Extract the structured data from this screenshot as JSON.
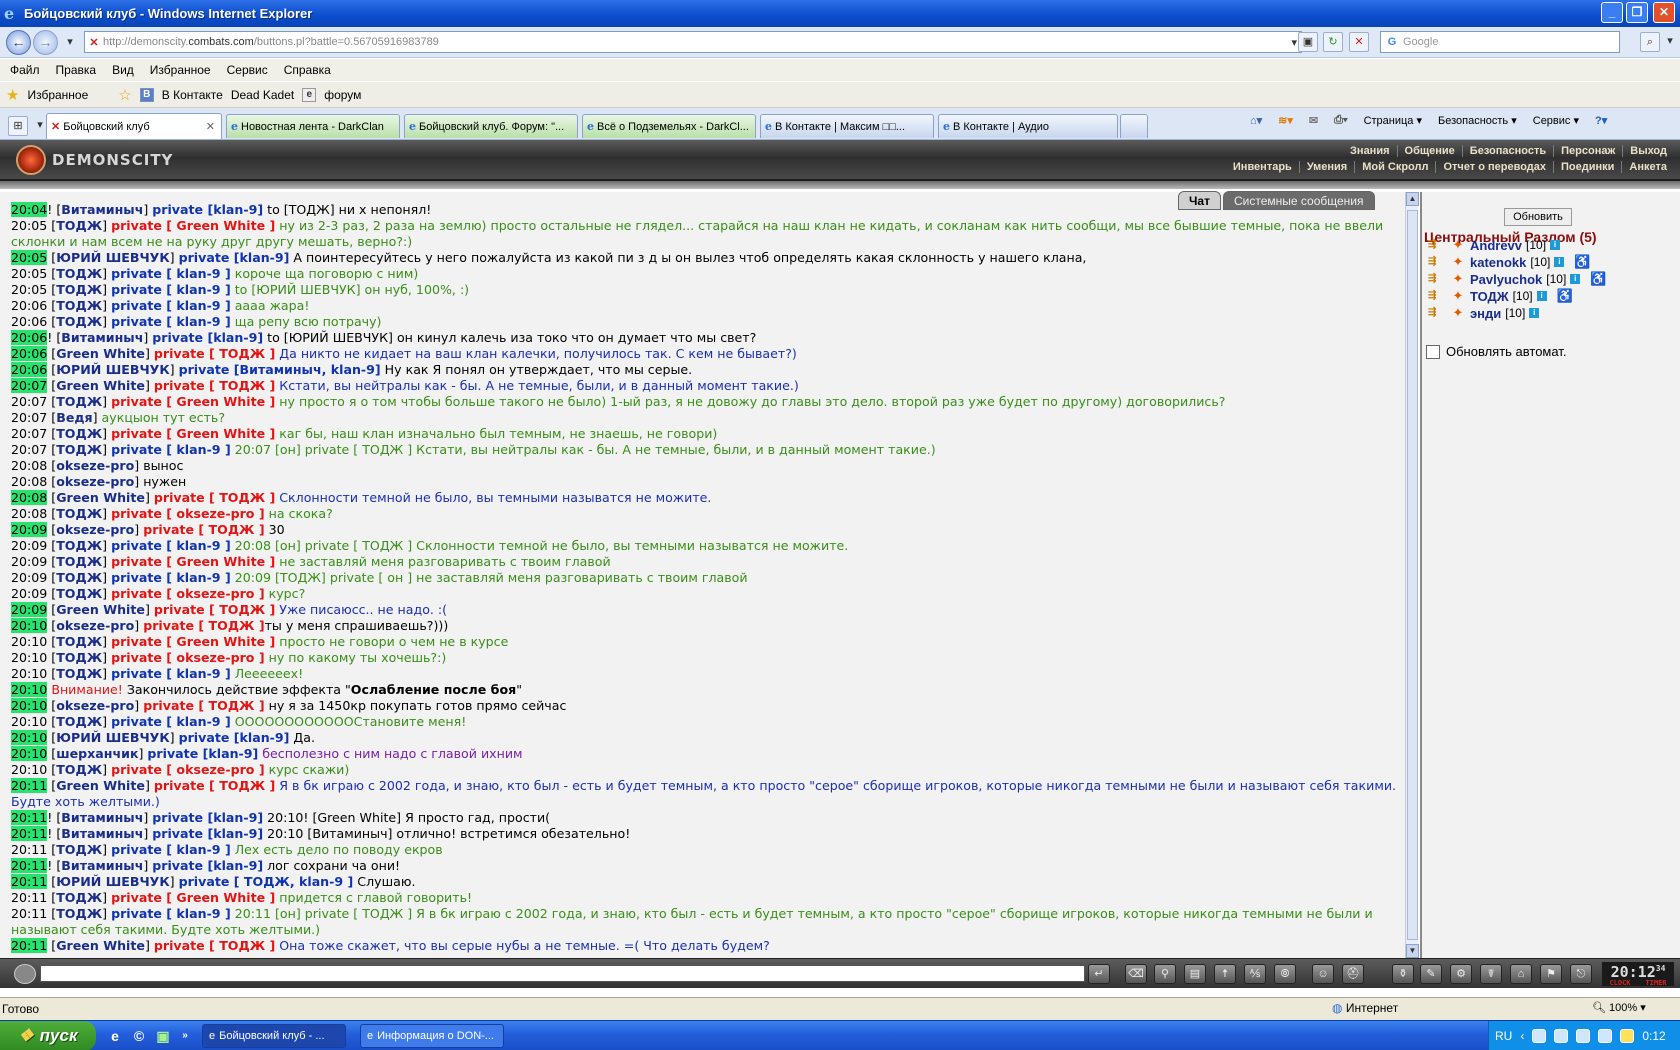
{
  "window": {
    "title": "Бойцовский клуб - Windows Internet Explorer"
  },
  "address": {
    "prefix": "http://demonscity.",
    "domain": "combats.com",
    "path": "/buttons.pl?battle=0.56705916983789"
  },
  "search": {
    "placeholder": "Google"
  },
  "menu": [
    "Файл",
    "Правка",
    "Вид",
    "Избранное",
    "Сервис",
    "Справка"
  ],
  "favorites": {
    "label": "Избранное",
    "items": [
      "В Контакте",
      "Dead Kadet",
      "форум"
    ]
  },
  "tabs": [
    {
      "label": "Бойцовский клуб",
      "active": true
    },
    {
      "label": "Новостная лента - DarkClan",
      "active": false
    },
    {
      "label": "Бойцовский клуб. Форум: \"...",
      "active": false
    },
    {
      "label": "Всё о Подземельях - DarkCl...",
      "active": false
    },
    {
      "label": "В Контакте | Максим □□...",
      "active": false
    },
    {
      "label": "В Контакте | Аудио",
      "active": false
    }
  ],
  "command_bar": [
    "Страница",
    "Безопасность",
    "Сервис"
  ],
  "game": {
    "logo": "DEMONSCITY",
    "nav_top": [
      "Знания",
      "Общение",
      "Безопасность",
      "Персонаж",
      "Выход"
    ],
    "nav_bottom": [
      "Инвентарь",
      "Умения",
      "Мой Скролл",
      "Отчет о переводах",
      "Поединки",
      "Анкета"
    ],
    "chat_tabs": [
      "Чат",
      "Системные сообщения"
    ]
  },
  "chat": [
    {
      "time": "20:04",
      "hl": true,
      "excl": true,
      "nick": "Витаминыч",
      "priv": "private [klan-9]",
      "pc": "p1",
      "text": " to [ТОДЖ] ни х непонял!",
      "tc": "c-dark"
    },
    {
      "time": "20:05",
      "hl": false,
      "excl": false,
      "nick": "ТОДЖ",
      "priv": "private [ Green White ]",
      "pc": "p2",
      "text": " ну из 2-3 раз, 2 раза на землю) просто остальные не глядел... старайся на наш клан не кидать, и сокланам как нить сообщи, мы все бывшие темные, пока не ввели склонки и нам всем не на руку друг другу мешать, верно?:)",
      "tc": "c-green"
    },
    {
      "time": "20:05",
      "hl": true,
      "excl": false,
      "nick": "ЮРИЙ ШЕВЧУК",
      "priv": "private [klan-9]",
      "pc": "p1",
      "text": " А поинтересуйтесь у него пожалуйста из какой пи з д ы он вылез чтоб определять какая склонность у нашего клана,",
      "tc": "c-dark"
    },
    {
      "time": "20:05",
      "hl": false,
      "excl": false,
      "nick": "ТОДЖ",
      "priv": "private [ klan-9 ]",
      "pc": "p1",
      "text": " короче ща поговорю с ним)",
      "tc": "c-green"
    },
    {
      "time": "20:05",
      "hl": false,
      "excl": false,
      "nick": "ТОДЖ",
      "priv": "private [ klan-9 ]",
      "pc": "p1",
      "text": " to [ЮРИЙ ШЕВЧУК] он нуб, 100%, :)",
      "tc": "c-green"
    },
    {
      "time": "20:06",
      "hl": false,
      "excl": false,
      "nick": "ТОДЖ",
      "priv": "private [ klan-9 ]",
      "pc": "p1",
      "text": " аааа жара!",
      "tc": "c-green"
    },
    {
      "time": "20:06",
      "hl": false,
      "excl": false,
      "nick": "ТОДЖ",
      "priv": "private [ klan-9 ]",
      "pc": "p1",
      "text": " ща репу всю потрачу)",
      "tc": "c-green"
    },
    {
      "time": "20:06",
      "hl": true,
      "excl": true,
      "nick": "Витаминыч",
      "priv": "private [klan-9]",
      "pc": "p1",
      "text": " to [ЮРИЙ ШЕВЧУК] он кинул калечь иза токо что он думает что мы свет?",
      "tc": "c-dark"
    },
    {
      "time": "20:06",
      "hl": true,
      "excl": false,
      "nick": "Green White",
      "priv": "private [ ТОДЖ ]",
      "pc": "p2",
      "text": " Да никто не кидает на ваш клан калечки, получилось так. С кем не бывает?)",
      "tc": "c-blue"
    },
    {
      "time": "20:06",
      "hl": true,
      "excl": false,
      "nick": "ЮРИЙ ШЕВЧУК",
      "priv": "private [Витаминыч, klan-9]",
      "pc": "p1",
      "text": " Ну как Я понял он утверждает, что мы серые.",
      "tc": "c-dark"
    },
    {
      "time": "20:07",
      "hl": true,
      "excl": false,
      "nick": "Green White",
      "priv": "private [ ТОДЖ ]",
      "pc": "p2",
      "text": " Кстати, вы нейтралы как - бы. А не темные, были, и в данный момент такие.)",
      "tc": "c-blue"
    },
    {
      "time": "20:07",
      "hl": false,
      "excl": false,
      "nick": "ТОДЖ",
      "priv": "private [ Green White ]",
      "pc": "p2",
      "text": " ну просто я о том чтобы больше такого не было) 1-ый раз, я не довожу до главы это дело. второй раз уже будет по другому) договорились?",
      "tc": "c-green"
    },
    {
      "time": "20:07",
      "hl": false,
      "excl": false,
      "nick": "Ведя",
      "priv": "",
      "pc": "p1",
      "text": " аукцыон тут есть?",
      "tc": "c-green"
    },
    {
      "time": "20:07",
      "hl": false,
      "excl": false,
      "nick": "ТОДЖ",
      "priv": "private [ Green White ]",
      "pc": "p2",
      "text": " каг бы, наш клан изначально был темным, не знаешь, не говори)",
      "tc": "c-green"
    },
    {
      "time": "20:07",
      "hl": false,
      "excl": false,
      "nick": "ТОДЖ",
      "priv": "private [ klan-9 ]",
      "pc": "p1",
      "text": " 20:07 [он] private [ ТОДЖ ] Кстати, вы нейтралы как - бы. А не темные, были, и в данный момент такие.)",
      "tc": "c-green"
    },
    {
      "time": "20:08",
      "hl": false,
      "excl": false,
      "nick": "okseze-pro",
      "priv": "",
      "pc": "p1",
      "text": " вынос",
      "tc": "c-dark"
    },
    {
      "time": "20:08",
      "hl": false,
      "excl": false,
      "nick": "okseze-pro",
      "priv": "",
      "pc": "p1",
      "text": " нужен",
      "tc": "c-dark"
    },
    {
      "time": "20:08",
      "hl": true,
      "excl": false,
      "nick": "Green White",
      "priv": "private [ ТОДЖ ]",
      "pc": "p2",
      "text": " Склонности темной не было, вы темными называтся не можите.",
      "tc": "c-blue"
    },
    {
      "time": "20:08",
      "hl": false,
      "excl": false,
      "nick": "ТОДЖ",
      "priv": "private [ okseze-pro ]",
      "pc": "p2",
      "text": " на скока?",
      "tc": "c-green"
    },
    {
      "time": "20:09",
      "hl": true,
      "excl": false,
      "nick": "okseze-pro",
      "priv": "private [ ТОДЖ ]",
      "pc": "p2",
      "text": " 30",
      "tc": "c-dark"
    },
    {
      "time": "20:09",
      "hl": false,
      "excl": false,
      "nick": "ТОДЖ",
      "priv": "private [ klan-9 ]",
      "pc": "p1",
      "text": " 20:08 [он] private [ ТОДЖ ] Склонности темной не было, вы темными называтся не можите.",
      "tc": "c-green"
    },
    {
      "time": "20:09",
      "hl": false,
      "excl": false,
      "nick": "ТОДЖ",
      "priv": "private [ Green White ]",
      "pc": "p2",
      "text": " не заставляй меня разговаривать с твоим главой",
      "tc": "c-green"
    },
    {
      "time": "20:09",
      "hl": false,
      "excl": false,
      "nick": "ТОДЖ",
      "priv": "private [ klan-9 ]",
      "pc": "p1",
      "text": " 20:09 [ТОДЖ] private [ он ] не заставляй меня разговаривать с твоим главой",
      "tc": "c-green"
    },
    {
      "time": "20:09",
      "hl": false,
      "excl": false,
      "nick": "ТОДЖ",
      "priv": "private [ okseze-pro ]",
      "pc": "p2",
      "text": " курс?",
      "tc": "c-green"
    },
    {
      "time": "20:09",
      "hl": true,
      "excl": false,
      "nick": "Green White",
      "priv": "private [ ТОДЖ ]",
      "pc": "p2",
      "text": " Уже писаюсс.. не надо. :(",
      "tc": "c-blue"
    },
    {
      "time": "20:10",
      "hl": true,
      "excl": false,
      "nick": "okseze-pro",
      "priv": "private [ ТОДЖ ]",
      "pc": "p2",
      "text": "ты у меня спрашиваешь?)))",
      "tc": "c-dark"
    },
    {
      "time": "20:10",
      "hl": false,
      "excl": false,
      "nick": "ТОДЖ",
      "priv": "private [ Green White ]",
      "pc": "p2",
      "text": " просто не говори о чем не в курсе",
      "tc": "c-green"
    },
    {
      "time": "20:10",
      "hl": false,
      "excl": false,
      "nick": "ТОДЖ",
      "priv": "private [ okseze-pro ]",
      "pc": "p2",
      "text": " ну по какому ты хочешь?:)",
      "tc": "c-green"
    },
    {
      "time": "20:10",
      "hl": false,
      "excl": false,
      "nick": "ТОДЖ",
      "priv": "private [ klan-9 ]",
      "pc": "p1",
      "text": " Леееееех!",
      "tc": "c-green"
    },
    {
      "time": "20:10",
      "hl": true,
      "excl": false,
      "system": true,
      "warn": "Внимание!",
      "text": " Закончилось действие эффекта \"",
      "bold": "Ослабление после боя",
      "text2": "\""
    },
    {
      "time": "20:10",
      "hl": true,
      "excl": false,
      "nick": "okseze-pro",
      "priv": "private [ ТОДЖ ]",
      "pc": "p2",
      "text": " ну я за 1450кр покупать готов прямо сейчас",
      "tc": "c-dark"
    },
    {
      "time": "20:10",
      "hl": false,
      "excl": false,
      "nick": "ТОДЖ",
      "priv": "private [ klan-9 ]",
      "pc": "p1",
      "text": " ООООООООООООСтановите меня!",
      "tc": "c-green"
    },
    {
      "time": "20:10",
      "hl": true,
      "excl": false,
      "nick": "ЮРИЙ ШЕВЧУК",
      "priv": "private [klan-9]",
      "pc": "p1",
      "text": " Да.",
      "tc": "c-dark"
    },
    {
      "time": "20:10",
      "hl": true,
      "excl": false,
      "nick": "шерханчик",
      "priv": "private [klan-9]",
      "pc": "p1",
      "text": " бесполезно с ним надо с главой ихним",
      "tc": "c-purple"
    },
    {
      "time": "20:10",
      "hl": false,
      "excl": false,
      "nick": "ТОДЖ",
      "priv": "private [ okseze-pro ]",
      "pc": "p2",
      "text": " курс скажи)",
      "tc": "c-green"
    },
    {
      "time": "20:11",
      "hl": true,
      "excl": false,
      "nick": "Green White",
      "priv": "private [ ТОДЖ ]",
      "pc": "p2",
      "text": " Я в бк играю с 2002 года, и знаю, кто был - есть и будет темным, а кто просто \"серое\" сборище игроков, которые никогда темными не были и называют себя такими. Будте хоть желтыми.)",
      "tc": "c-blue"
    },
    {
      "time": "20:11",
      "hl": true,
      "excl": true,
      "nick": "Витаминыч",
      "priv": "private [klan-9]",
      "pc": "p1",
      "text": " 20:10! [Green White] Я просто гад, прости(",
      "tc": "c-dark"
    },
    {
      "time": "20:11",
      "hl": true,
      "excl": true,
      "nick": "Витаминыч",
      "priv": "private [klan-9]",
      "pc": "p1",
      "text": " 20:10 [Витаминыч] отлично! встретимся обезательно!",
      "tc": "c-dark"
    },
    {
      "time": "20:11",
      "hl": false,
      "excl": false,
      "nick": "ТОДЖ",
      "priv": "private [ klan-9 ]",
      "pc": "p1",
      "text": " Лех есть дело по поводу екров",
      "tc": "c-green"
    },
    {
      "time": "20:11",
      "hl": true,
      "excl": true,
      "nick": "Витаминыч",
      "priv": "private [klan-9]",
      "pc": "p1",
      "text": " лог сохрани ча они!",
      "tc": "c-dark"
    },
    {
      "time": "20:11",
      "hl": true,
      "excl": false,
      "nick": "ЮРИЙ ШЕВЧУК",
      "priv": "private [ ТОДЖ, klan-9 ]",
      "pc": "p1",
      "text": " Слушаю.",
      "tc": "c-dark"
    },
    {
      "time": "20:11",
      "hl": false,
      "excl": false,
      "nick": "ТОДЖ",
      "priv": "private [ Green White ]",
      "pc": "p2",
      "text": " придется с главой говорить!",
      "tc": "c-green"
    },
    {
      "time": "20:11",
      "hl": false,
      "excl": false,
      "nick": "ТОДЖ",
      "priv": "private [ klan-9 ]",
      "pc": "p1",
      "text": " 20:11 [он] private [ ТОДЖ ] Я в бк играю с 2002 года, и знаю, кто был - есть и будет темным, а кто просто \"серое\" сборище игроков, которые никогда темными не были и называют себя такими. Будте хоть желтыми.)",
      "tc": "c-green"
    },
    {
      "time": "20:11",
      "hl": true,
      "excl": false,
      "nick": "Green White",
      "priv": "private [ ТОДЖ ]",
      "pc": "p2",
      "text": " Она тоже скажет, что вы серые нубы а не темные. =( Что делать будем?",
      "tc": "c-blue"
    }
  ],
  "side": {
    "refresh": "Обновить",
    "location": "Центральный Разлом (5)",
    "users": [
      {
        "name": "Andrevv",
        "level": "[10]",
        "extra": ""
      },
      {
        "name": "katenokk",
        "level": "[10]",
        "extra": "♿"
      },
      {
        "name": "Pavlyuchok",
        "level": "[10]",
        "extra": "♿"
      },
      {
        "name": "ТОДЖ",
        "level": "[10]",
        "extra": "♿"
      },
      {
        "name": "энди",
        "level": "[10]",
        "extra": ""
      }
    ],
    "auto_refresh": "Обновлять автомат."
  },
  "clock": {
    "time": "20:12",
    "sec": "34",
    "l1": "CLOCK",
    "l2": "TIMER"
  },
  "status": {
    "text": "Готово",
    "zone": "Интернет",
    "zoom": "100%"
  },
  "taskbar": {
    "start": "пуск",
    "tasks": [
      "Бойцовский клуб - ...",
      "Информация о DON-..."
    ],
    "lang": "RU",
    "time": "0:12"
  }
}
